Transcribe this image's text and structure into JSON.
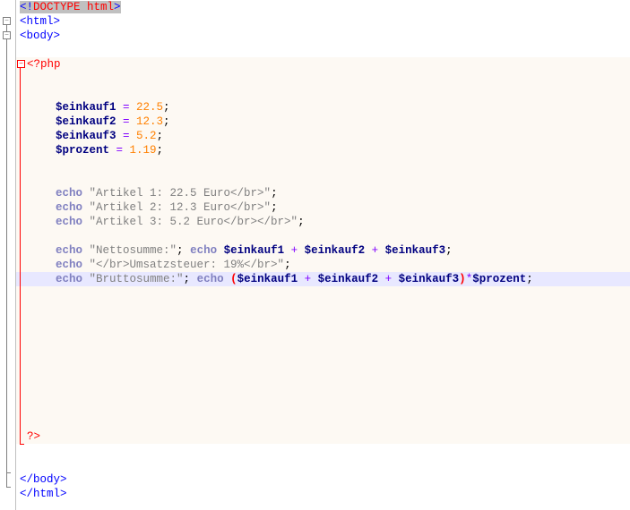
{
  "code": {
    "doctype_open": "<!",
    "doctype_text": "DOCTYPE html",
    "doctype_close": ">",
    "html_open": "<html>",
    "body_open": "<body>",
    "php_open": "<?php",
    "php_close": "?>",
    "body_close": "</body>",
    "html_close": "</html>",
    "var1": "$einkauf1 ",
    "var2": "$einkauf2 ",
    "var3": "$einkauf3 ",
    "var4": "$prozent ",
    "eq": "= ",
    "val1": "22.5",
    "val2": "12.3",
    "val3": "5.2",
    "val4": "1.19",
    "semi": ";",
    "echo": "echo ",
    "str1": "\"Artikel 1: 22.5 Euro</br>\"",
    "str2": "\"Artikel 2: 12.3 Euro</br>\"",
    "str3": "\"Artikel 3: 5.2 Euro</br></br>\"",
    "str4": "\"Nettosumme:\"",
    "str5": "\"</br>Umsatzsteuer: 19%</br>\"",
    "str6": "\"Bruttosumme:\"",
    "v_e1": "$einkauf1 ",
    "v_e2": " $einkauf2 ",
    "v_e3": " $einkauf3",
    "plus": "+",
    "star": "*",
    "lp": "(",
    "rp": ")",
    "v_pz": "$prozent",
    "sep": "; "
  },
  "fold": {
    "minus": "−"
  }
}
